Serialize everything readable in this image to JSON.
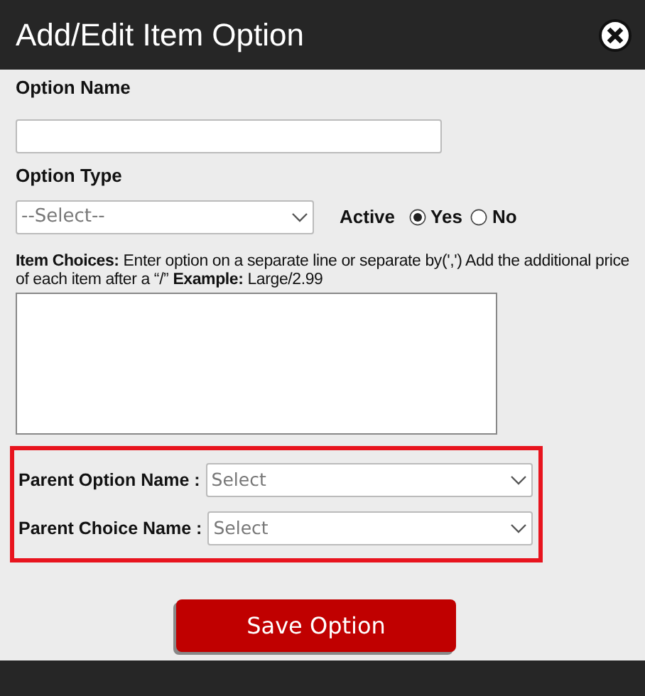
{
  "dialog": {
    "title": "Add/Edit Item Option"
  },
  "option_name": {
    "label": "Option Name"
  },
  "option_type": {
    "label": "Option Type",
    "value": "--Select--"
  },
  "active": {
    "label": "Active",
    "options": [
      {
        "label": "Yes",
        "selected": true
      },
      {
        "label": "No",
        "selected": false
      }
    ]
  },
  "item_choices": {
    "help": "**Item Choices:** Enter option on a separate line or separate by(',') Add the additional price of each item after a “/” **Example:** Large/2.99"
  },
  "highlight": {
    "highlighted": true,
    "fields": [
      {
        "label": "Parent Option Name :",
        "value": "Select"
      },
      {
        "label": "Parent Choice Name :",
        "value": "Select"
      }
    ]
  },
  "save_button": "Save Option"
}
